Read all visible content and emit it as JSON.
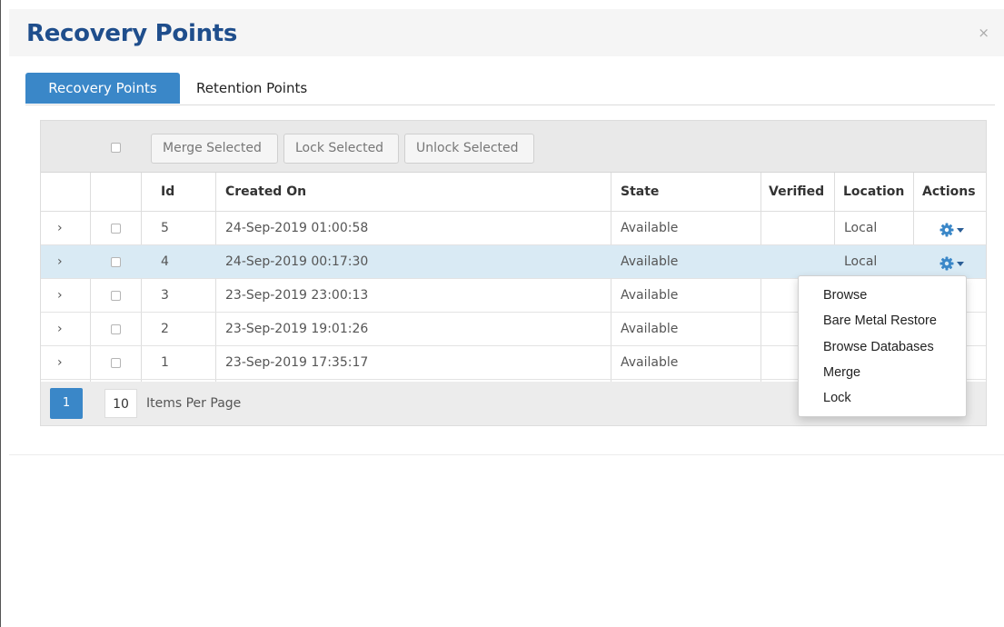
{
  "modal": {
    "title": "Recovery Points",
    "close_label": "×"
  },
  "tabs": [
    {
      "label": "Recovery Points",
      "active": true
    },
    {
      "label": "Retention Points",
      "active": false
    }
  ],
  "toolbar": {
    "merge_label": "Merge Selected",
    "lock_label": "Lock Selected",
    "unlock_label": "Unlock Selected"
  },
  "columns": {
    "id": "Id",
    "created_on": "Created On",
    "state": "State",
    "verified": "Verified",
    "location": "Location",
    "actions": "Actions"
  },
  "rows": [
    {
      "expand": "›",
      "id": "5",
      "created_on": "24-Sep-2019 01:00:58",
      "state": "Available",
      "verified": "",
      "location": "Local",
      "selected": false
    },
    {
      "expand": "›",
      "id": "4",
      "created_on": "24-Sep-2019 00:17:30",
      "state": "Available",
      "verified": "",
      "location": "Local",
      "selected": true
    },
    {
      "expand": "›",
      "id": "3",
      "created_on": "23-Sep-2019 23:00:13",
      "state": "Available",
      "verified": "",
      "location": "",
      "selected": false
    },
    {
      "expand": "›",
      "id": "2",
      "created_on": "23-Sep-2019 19:01:26",
      "state": "Available",
      "verified": "",
      "location": "",
      "selected": false
    },
    {
      "expand": "›",
      "id": "1",
      "created_on": "23-Sep-2019 17:35:17",
      "state": "Available",
      "verified": "",
      "location": "",
      "selected": false
    }
  ],
  "pager": {
    "current_page": "1",
    "items_per_page": "10",
    "items_per_page_label": "Items Per Page"
  },
  "actions_menu": {
    "items": [
      "Browse",
      "Bare Metal Restore",
      "Browse Databases",
      "Merge",
      "Lock"
    ]
  },
  "colors": {
    "accent": "#3a87c8",
    "title": "#1f4e8c",
    "gear": "#3a87c8",
    "selected_row": "#d9eaf4"
  },
  "icons": {
    "expand": "chevron-right-icon",
    "actions": "gear-icon",
    "caret": "caret-down-icon",
    "close": "close-icon"
  }
}
